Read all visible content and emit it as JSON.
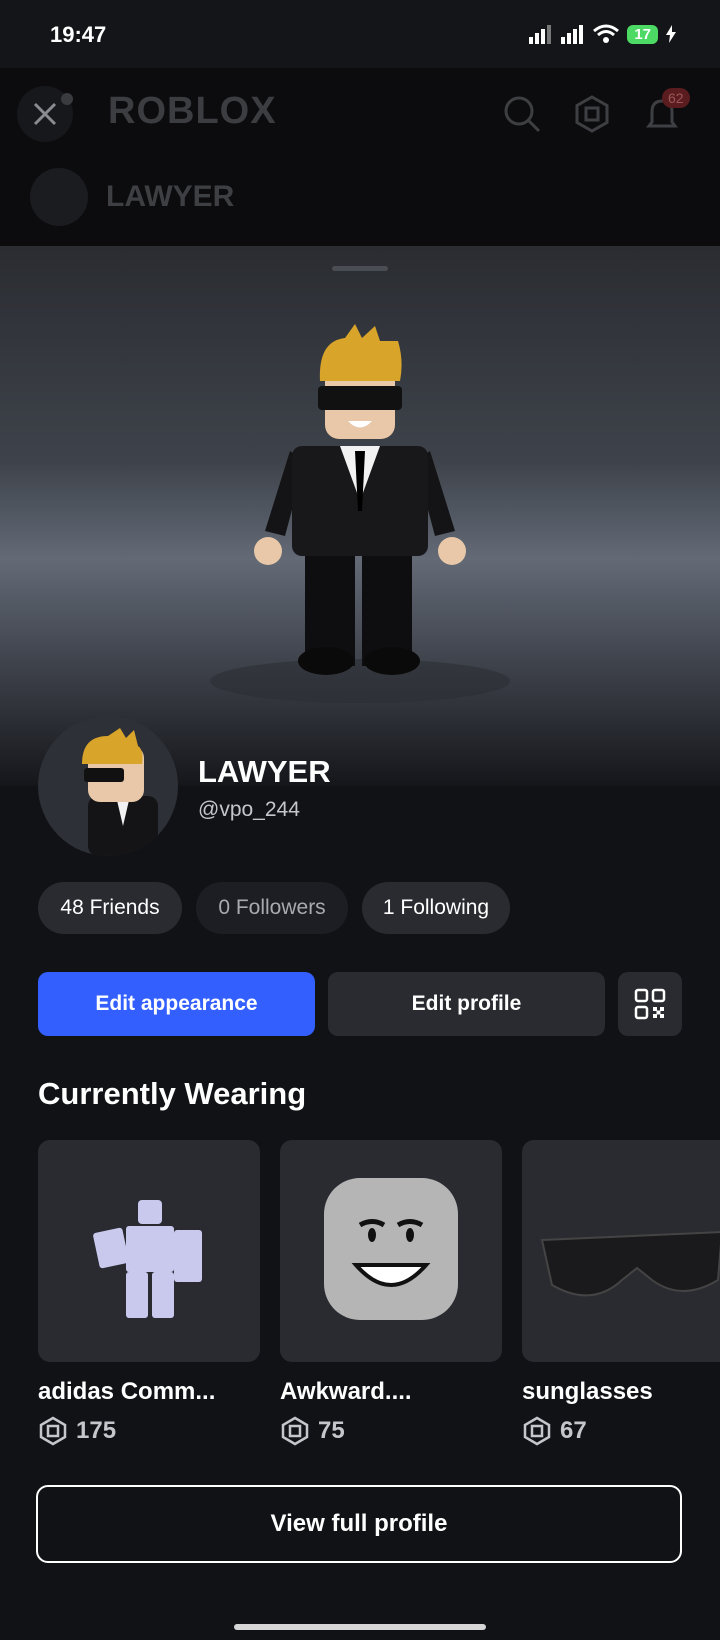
{
  "status": {
    "time": "19:47",
    "battery": "17"
  },
  "header": {
    "logo": "ROBLOX",
    "notification_count": "62",
    "profile_name": "LAWYER"
  },
  "profile": {
    "display_name": "LAWYER",
    "username": "@vpo_244"
  },
  "stats": {
    "friends": "48 Friends",
    "followers": "0 Followers",
    "following": "1 Following"
  },
  "actions": {
    "edit_appearance": "Edit appearance",
    "edit_profile": "Edit profile"
  },
  "wearing": {
    "title": "Currently Wearing",
    "items": [
      {
        "name": "adidas Comm...",
        "price": "175"
      },
      {
        "name": "Awkward....",
        "price": "75"
      },
      {
        "name": "sunglasses",
        "price": "67"
      }
    ]
  },
  "footer": {
    "view_full_profile": "View full profile"
  },
  "colors": {
    "primary": "#335fff",
    "background": "#111216",
    "card": "#2a2b31"
  },
  "icons": [
    "close-icon",
    "search-icon",
    "robux-icon",
    "bell-icon",
    "qr-code-icon"
  ]
}
